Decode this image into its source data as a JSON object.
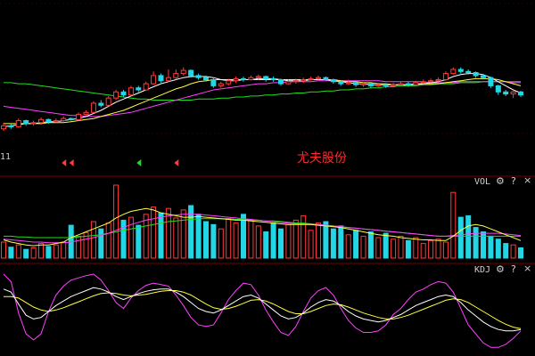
{
  "stock_name": "尤夫股份",
  "start_tick_label": "11",
  "vol_panel": {
    "label": "VOL",
    "settings_icon": "gear-icon",
    "help_label": "?",
    "close_label": "×"
  },
  "kdj_panel": {
    "label": "KDJ",
    "settings_icon": "gear-icon",
    "help_label": "?",
    "close_label": "×"
  },
  "colors": {
    "up": "#ff3b3b",
    "down": "#23d6e6",
    "ma5": "#ffffff",
    "ma10": "#ffff40",
    "ma20": "#ff40ff",
    "ma60": "#20e020",
    "k": "#ffffff",
    "d": "#ffff40",
    "j": "#ff40ff",
    "grid": "#7a0000"
  },
  "chart_data": [
    {
      "type": "candlestick",
      "title": "",
      "ylim": [
        0,
        100
      ],
      "signals": [
        {
          "index": 8,
          "kind": "sell",
          "color": "#ff3b3b"
        },
        {
          "index": 9,
          "kind": "sell",
          "color": "#ff3b3b"
        },
        {
          "index": 18,
          "kind": "buy",
          "color": "#20e020"
        },
        {
          "index": 23,
          "kind": "sell",
          "color": "#ff3b3b"
        }
      ],
      "candles": [
        {
          "o": 22,
          "c": 25,
          "h": 28,
          "l": 20
        },
        {
          "o": 25,
          "c": 24,
          "h": 27,
          "l": 22
        },
        {
          "o": 24,
          "c": 30,
          "h": 32,
          "l": 23
        },
        {
          "o": 30,
          "c": 27,
          "h": 31,
          "l": 25
        },
        {
          "o": 27,
          "c": 28,
          "h": 30,
          "l": 25
        },
        {
          "o": 28,
          "c": 31,
          "h": 33,
          "l": 26
        },
        {
          "o": 31,
          "c": 29,
          "h": 32,
          "l": 27
        },
        {
          "o": 29,
          "c": 30,
          "h": 32,
          "l": 28
        },
        {
          "o": 30,
          "c": 32,
          "h": 34,
          "l": 29
        },
        {
          "o": 32,
          "c": 31,
          "h": 33,
          "l": 30
        },
        {
          "o": 31,
          "c": 36,
          "h": 38,
          "l": 30
        },
        {
          "o": 36,
          "c": 38,
          "h": 40,
          "l": 35
        },
        {
          "o": 38,
          "c": 47,
          "h": 49,
          "l": 37
        },
        {
          "o": 47,
          "c": 45,
          "h": 50,
          "l": 43
        },
        {
          "o": 45,
          "c": 52,
          "h": 54,
          "l": 44
        },
        {
          "o": 52,
          "c": 58,
          "h": 60,
          "l": 50
        },
        {
          "o": 58,
          "c": 55,
          "h": 60,
          "l": 53
        },
        {
          "o": 55,
          "c": 62,
          "h": 64,
          "l": 54
        },
        {
          "o": 62,
          "c": 60,
          "h": 64,
          "l": 58
        },
        {
          "o": 60,
          "c": 66,
          "h": 68,
          "l": 59
        },
        {
          "o": 66,
          "c": 74,
          "h": 78,
          "l": 65
        },
        {
          "o": 74,
          "c": 69,
          "h": 76,
          "l": 67
        },
        {
          "o": 69,
          "c": 72,
          "h": 80,
          "l": 68
        },
        {
          "o": 72,
          "c": 76,
          "h": 80,
          "l": 70
        },
        {
          "o": 76,
          "c": 79,
          "h": 82,
          "l": 74
        },
        {
          "o": 79,
          "c": 74,
          "h": 80,
          "l": 72
        },
        {
          "o": 74,
          "c": 72,
          "h": 76,
          "l": 70
        },
        {
          "o": 72,
          "c": 70,
          "h": 74,
          "l": 68
        },
        {
          "o": 70,
          "c": 64,
          "h": 72,
          "l": 62
        },
        {
          "o": 64,
          "c": 66,
          "h": 68,
          "l": 62
        },
        {
          "o": 66,
          "c": 69,
          "h": 71,
          "l": 64
        },
        {
          "o": 69,
          "c": 71,
          "h": 73,
          "l": 67
        },
        {
          "o": 71,
          "c": 70,
          "h": 73,
          "l": 68
        },
        {
          "o": 70,
          "c": 72,
          "h": 74,
          "l": 69
        },
        {
          "o": 72,
          "c": 73,
          "h": 75,
          "l": 70
        },
        {
          "o": 73,
          "c": 71,
          "h": 74,
          "l": 68
        },
        {
          "o": 71,
          "c": 70,
          "h": 73,
          "l": 68
        },
        {
          "o": 70,
          "c": 66,
          "h": 71,
          "l": 64
        },
        {
          "o": 66,
          "c": 68,
          "h": 70,
          "l": 65
        },
        {
          "o": 68,
          "c": 69,
          "h": 71,
          "l": 66
        },
        {
          "o": 69,
          "c": 70,
          "h": 72,
          "l": 67
        },
        {
          "o": 70,
          "c": 71,
          "h": 73,
          "l": 69
        },
        {
          "o": 71,
          "c": 72,
          "h": 74,
          "l": 70
        },
        {
          "o": 72,
          "c": 70,
          "h": 73,
          "l": 69
        },
        {
          "o": 70,
          "c": 68,
          "h": 71,
          "l": 66
        },
        {
          "o": 68,
          "c": 66,
          "h": 69,
          "l": 64
        },
        {
          "o": 66,
          "c": 67,
          "h": 70,
          "l": 65
        },
        {
          "o": 67,
          "c": 65,
          "h": 68,
          "l": 63
        },
        {
          "o": 65,
          "c": 66,
          "h": 68,
          "l": 63
        },
        {
          "o": 66,
          "c": 64,
          "h": 67,
          "l": 62
        },
        {
          "o": 64,
          "c": 65,
          "h": 67,
          "l": 63
        },
        {
          "o": 65,
          "c": 64,
          "h": 66,
          "l": 62
        },
        {
          "o": 64,
          "c": 65,
          "h": 67,
          "l": 63
        },
        {
          "o": 65,
          "c": 66,
          "h": 68,
          "l": 64
        },
        {
          "o": 66,
          "c": 65,
          "h": 68,
          "l": 63
        },
        {
          "o": 65,
          "c": 67,
          "h": 69,
          "l": 64
        },
        {
          "o": 67,
          "c": 68,
          "h": 70,
          "l": 66
        },
        {
          "o": 68,
          "c": 69,
          "h": 71,
          "l": 67
        },
        {
          "o": 69,
          "c": 70,
          "h": 72,
          "l": 68
        },
        {
          "o": 70,
          "c": 76,
          "h": 78,
          "l": 69
        },
        {
          "o": 76,
          "c": 80,
          "h": 82,
          "l": 75
        },
        {
          "o": 80,
          "c": 78,
          "h": 82,
          "l": 76
        },
        {
          "o": 78,
          "c": 77,
          "h": 80,
          "l": 75
        },
        {
          "o": 77,
          "c": 74,
          "h": 78,
          "l": 72
        },
        {
          "o": 74,
          "c": 72,
          "h": 75,
          "l": 70
        },
        {
          "o": 72,
          "c": 64,
          "h": 73,
          "l": 62
        },
        {
          "o": 64,
          "c": 58,
          "h": 65,
          "l": 55
        },
        {
          "o": 58,
          "c": 56,
          "h": 60,
          "l": 54
        },
        {
          "o": 56,
          "c": 58,
          "h": 60,
          "l": 52
        },
        {
          "o": 58,
          "c": 55,
          "h": 59,
          "l": 53
        }
      ],
      "ma": {
        "ma5": [
          24,
          25,
          26,
          27,
          27,
          28,
          29,
          29,
          30,
          31,
          32,
          34,
          37,
          40,
          44,
          48,
          51,
          54,
          57,
          60,
          63,
          66,
          68,
          70,
          72,
          73,
          73,
          73,
          72,
          70,
          69,
          69,
          70,
          70,
          71,
          71,
          71,
          70,
          69,
          69,
          69,
          70,
          70,
          70,
          69,
          68,
          67,
          66,
          66,
          65,
          65,
          65,
          65,
          65,
          65,
          66,
          66,
          67,
          68,
          70,
          73,
          75,
          76,
          76,
          75,
          72,
          68,
          64,
          60,
          57
        ],
        "ma10": [
          27,
          27,
          27,
          27,
          27,
          27,
          28,
          28,
          28,
          29,
          30,
          31,
          32,
          34,
          36,
          38,
          40,
          43,
          46,
          49,
          52,
          55,
          58,
          61,
          63,
          66,
          68,
          69,
          70,
          70,
          70,
          70,
          70,
          70,
          70,
          70,
          70,
          70,
          70,
          70,
          70,
          70,
          70,
          70,
          70,
          69,
          68,
          68,
          67,
          67,
          66,
          66,
          65,
          65,
          65,
          65,
          66,
          66,
          66,
          67,
          68,
          69,
          70,
          71,
          71,
          71,
          70,
          68,
          66,
          64
        ],
        "ma20": [
          44,
          43,
          42,
          41,
          40,
          39,
          38,
          37,
          36,
          35,
          35,
          34,
          34,
          34,
          35,
          36,
          37,
          38,
          40,
          42,
          44,
          46,
          48,
          50,
          52,
          54,
          56,
          58,
          60,
          61,
          62,
          63,
          64,
          65,
          66,
          66,
          67,
          67,
          68,
          68,
          68,
          68,
          69,
          69,
          69,
          69,
          69,
          69,
          69,
          69,
          69,
          68,
          68,
          68,
          68,
          68,
          68,
          67,
          67,
          67,
          67,
          68,
          68,
          68,
          68,
          68,
          68,
          68,
          67,
          67
        ],
        "ma60": [
          67,
          67,
          66,
          66,
          65,
          64,
          63,
          62,
          61,
          60,
          59,
          58,
          57,
          56,
          55,
          54,
          53,
          52,
          51,
          51,
          50,
          50,
          50,
          50,
          50,
          50,
          51,
          51,
          51,
          52,
          52,
          53,
          53,
          54,
          54,
          55,
          55,
          56,
          56,
          57,
          57,
          58,
          58,
          59,
          59,
          60,
          60,
          61,
          61,
          62,
          62,
          63,
          63,
          64,
          64,
          64,
          65,
          65,
          66,
          66,
          66,
          67,
          67,
          67,
          68,
          68,
          68,
          68,
          68,
          68
        ]
      }
    },
    {
      "type": "bar",
      "title": "VOL",
      "ylim": [
        0,
        100
      ],
      "values": [
        22,
        15,
        18,
        12,
        14,
        20,
        16,
        18,
        22,
        45,
        30,
        35,
        50,
        40,
        48,
        100,
        52,
        56,
        45,
        60,
        70,
        62,
        68,
        55,
        66,
        72,
        60,
        50,
        46,
        40,
        54,
        48,
        60,
        52,
        44,
        36,
        48,
        40,
        46,
        52,
        58,
        38,
        48,
        50,
        40,
        44,
        32,
        38,
        30,
        36,
        28,
        34,
        26,
        30,
        24,
        28,
        20,
        24,
        26,
        22,
        90,
        56,
        58,
        42,
        36,
        30,
        26,
        20,
        18,
        14
      ],
      "ma1": [
        25,
        22,
        20,
        18,
        17,
        18,
        18,
        20,
        22,
        28,
        32,
        36,
        40,
        44,
        48,
        55,
        60,
        64,
        66,
        68,
        66,
        62,
        60,
        58,
        56,
        56,
        57,
        56,
        55,
        54,
        53,
        52,
        52,
        51,
        50,
        49,
        48,
        47,
        46,
        46,
        46,
        46,
        45,
        44,
        43,
        42,
        40,
        38,
        36,
        34,
        32,
        31,
        30,
        28,
        27,
        26,
        25,
        25,
        24,
        24,
        30,
        38,
        44,
        46,
        44,
        40,
        36,
        32,
        28,
        24
      ],
      "ma2": [
        26,
        25,
        24,
        23,
        22,
        22,
        21,
        21,
        21,
        22,
        24,
        26,
        28,
        31,
        34,
        38,
        42,
        46,
        49,
        52,
        54,
        56,
        58,
        59,
        60,
        60,
        60,
        59,
        58,
        57,
        56,
        55,
        54,
        53,
        52,
        51,
        50,
        49,
        48,
        47,
        47,
        46,
        46,
        45,
        44,
        43,
        42,
        41,
        40,
        39,
        38,
        37,
        36,
        35,
        34,
        33,
        32,
        31,
        30,
        30,
        31,
        32,
        33,
        34,
        34,
        34,
        34,
        33,
        32,
        31
      ],
      "ma3": [
        30,
        30,
        29,
        29,
        28,
        28,
        28,
        28,
        28,
        28,
        29,
        30,
        31,
        32,
        34,
        36,
        38,
        40,
        42,
        44,
        46,
        48,
        50,
        51,
        52,
        53,
        54,
        54,
        54,
        54,
        54,
        53,
        53,
        52,
        52,
        51,
        51,
        50,
        49,
        48,
        48,
        47,
        46,
        45,
        44,
        43,
        42,
        41,
        40,
        39,
        38,
        37,
        36,
        35,
        34,
        33,
        32,
        31,
        30,
        30,
        30,
        30,
        30,
        30,
        30,
        30,
        30,
        30,
        30,
        30
      ]
    },
    {
      "type": "line",
      "title": "KDJ",
      "ylim": [
        0,
        100
      ],
      "k": [
        80,
        76,
        60,
        45,
        40,
        42,
        50,
        58,
        64,
        70,
        74,
        78,
        82,
        80,
        76,
        70,
        66,
        70,
        74,
        77,
        79,
        80,
        80,
        76,
        70,
        62,
        54,
        50,
        48,
        52,
        58,
        64,
        70,
        72,
        68,
        60,
        52,
        44,
        40,
        42,
        48,
        56,
        62,
        66,
        64,
        58,
        50,
        44,
        40,
        38,
        36,
        38,
        42,
        46,
        52,
        58,
        62,
        66,
        70,
        72,
        70,
        62,
        52,
        44,
        36,
        30,
        26,
        24,
        24,
        26
      ],
      "d": [
        70,
        70,
        68,
        62,
        56,
        52,
        50,
        52,
        55,
        59,
        63,
        67,
        71,
        74,
        75,
        74,
        72,
        71,
        72,
        73,
        75,
        77,
        78,
        78,
        76,
        72,
        66,
        60,
        55,
        53,
        54,
        57,
        61,
        65,
        66,
        64,
        60,
        55,
        50,
        47,
        47,
        50,
        54,
        58,
        60,
        59,
        56,
        52,
        48,
        45,
        42,
        40,
        40,
        42,
        45,
        49,
        53,
        57,
        61,
        65,
        67,
        66,
        62,
        56,
        50,
        44,
        38,
        33,
        29,
        27
      ],
      "j": [
        100,
        90,
        48,
        20,
        12,
        20,
        50,
        72,
        84,
        92,
        95,
        98,
        100,
        92,
        78,
        62,
        54,
        68,
        78,
        85,
        88,
        86,
        84,
        72,
        58,
        42,
        32,
        30,
        32,
        48,
        66,
        78,
        88,
        86,
        72,
        52,
        36,
        22,
        18,
        30,
        50,
        68,
        78,
        82,
        72,
        54,
        38,
        28,
        22,
        22,
        24,
        32,
        46,
        54,
        66,
        76,
        80,
        86,
        90,
        88,
        76,
        54,
        32,
        20,
        8,
        2,
        2,
        6,
        14,
        24
      ]
    }
  ]
}
